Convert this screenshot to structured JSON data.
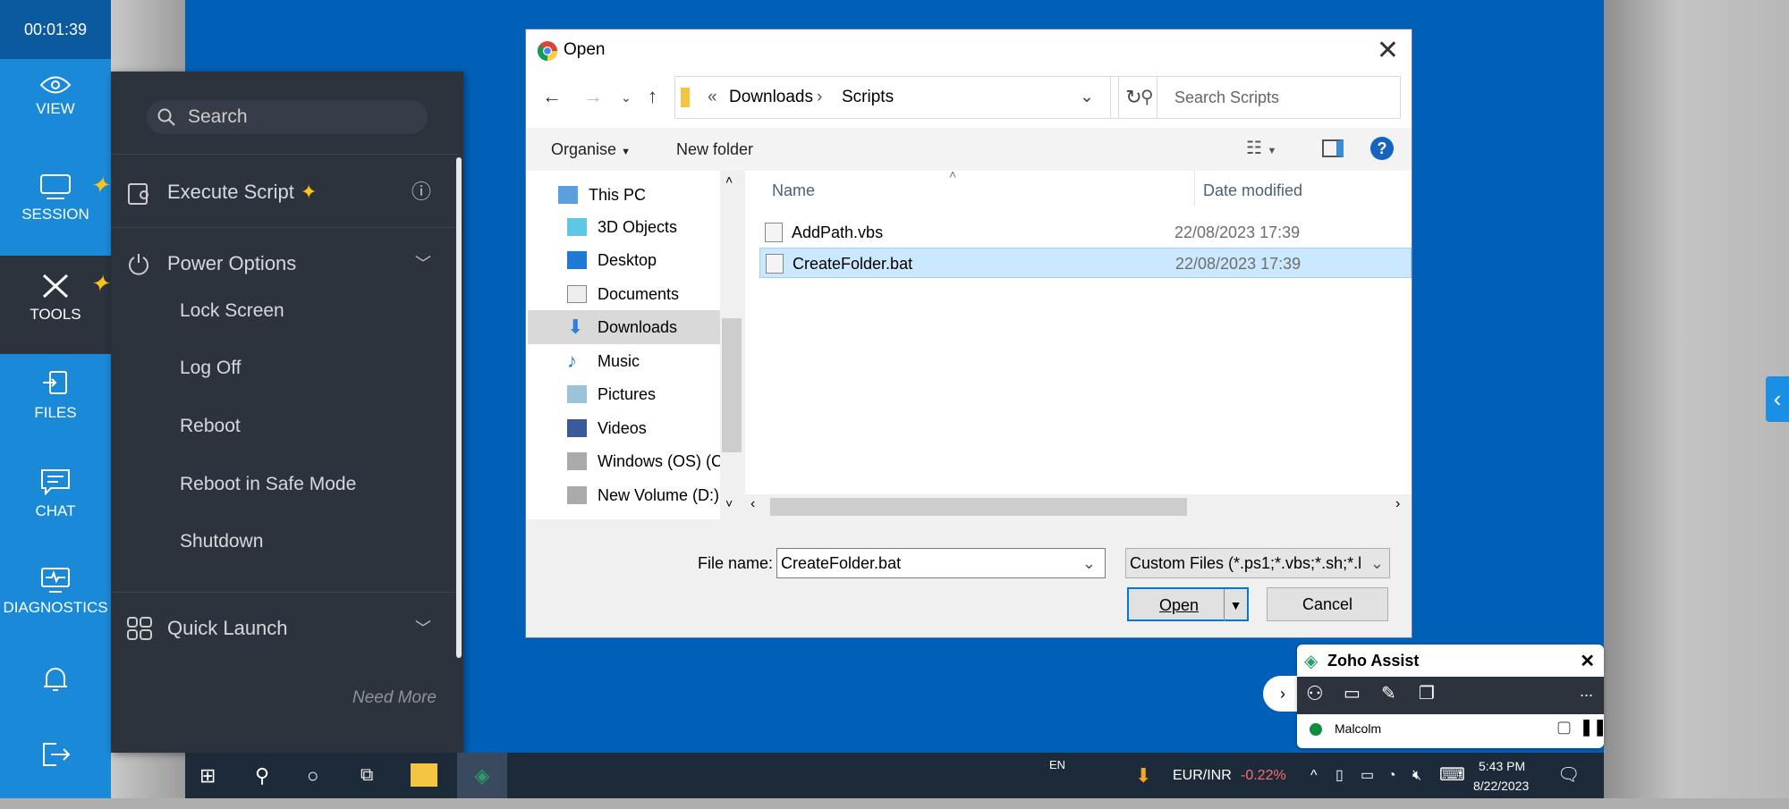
{
  "session_timer": "00:01:39",
  "nav": [
    {
      "label": "VIEW",
      "icon": "eye-icon"
    },
    {
      "label": "SESSION",
      "icon": "monitor-icon"
    },
    {
      "label": "TOOLS",
      "icon": "tools-icon"
    },
    {
      "label": "FILES",
      "icon": "files-icon"
    },
    {
      "label": "CHAT",
      "icon": "chat-icon"
    },
    {
      "label": "DIAGNOSTICS",
      "icon": "diagnostics-icon"
    },
    {
      "label": "",
      "icon": "bell-icon"
    },
    {
      "label": "",
      "icon": "exit-icon"
    }
  ],
  "menu": {
    "search_placeholder": "Search",
    "execute_script": "Execute Script",
    "power_options": "Power Options",
    "power_items": [
      "Lock Screen",
      "Log Off",
      "Reboot",
      "Reboot in Safe Mode",
      "Shutdown"
    ],
    "quick_launch": "Quick Launch",
    "need_more": "Need More"
  },
  "dialog": {
    "title": "Open",
    "breadcrumb": [
      "Downloads",
      "Scripts"
    ],
    "search_placeholder": "Search Scripts",
    "organise": "Organise",
    "new_folder": "New folder",
    "tree": [
      "This PC",
      "3D Objects",
      "Desktop",
      "Documents",
      "Downloads",
      "Music",
      "Pictures",
      "Videos",
      "Windows (OS) (C",
      "New Volume (D:)"
    ],
    "columns": {
      "name": "Name",
      "date": "Date modified"
    },
    "files": [
      {
        "name": "AddPath.vbs",
        "date": "22/08/2023 17:39"
      },
      {
        "name": "CreateFolder.bat",
        "date": "22/08/2023 17:39"
      }
    ],
    "file_name_label": "File name:",
    "file_name_value": "CreateFolder.bat",
    "file_type": "Custom Files (*.ps1;*.vbs;*.sh;*.l",
    "open": "Open",
    "cancel": "Cancel"
  },
  "zoho": {
    "title": "Zoho Assist",
    "user": "Malcolm",
    "more": "..."
  },
  "taskbar": {
    "lang": "EN",
    "ticker": "EUR/INR",
    "ticker_change": "-0.22%",
    "time": "5:43 PM",
    "date": "8/22/2023"
  },
  "colors": {
    "nav": "#1a8ad8",
    "panel": "#2c333d",
    "desktop": "#0060b8",
    "selection": "#cce8ff",
    "ticker_down": "#ff6b6b"
  }
}
